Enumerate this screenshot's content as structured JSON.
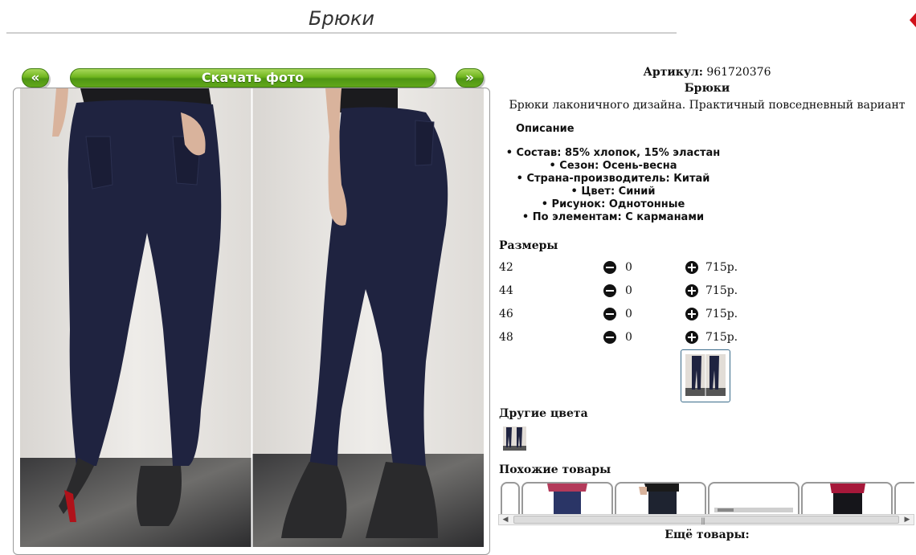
{
  "page": {
    "title": "Брюки"
  },
  "nav": {
    "prev_label": "«",
    "download_label": "Скачать фото",
    "next_label": "»"
  },
  "product": {
    "article_label": "Артикул:",
    "article_value": "961720376",
    "name": "Брюки",
    "short_description": "Брюки лаконичного дизайна. Практичный повседневный вариант"
  },
  "description": {
    "heading": "Описание",
    "items": [
      "Состав: 85% хлопок, 15% эластан",
      "Сезон: Осень-весна",
      "Страна-производитель: Китай",
      "Цвет: Синий",
      "Рисунок: Однотонные",
      "По элементам: С карманами"
    ]
  },
  "sizes": {
    "heading": "Размеры",
    "rows": [
      {
        "size": "42",
        "qty": "0",
        "price": "715р."
      },
      {
        "size": "44",
        "qty": "0",
        "price": "715р."
      },
      {
        "size": "46",
        "qty": "0",
        "price": "715р."
      },
      {
        "size": "48",
        "qty": "0",
        "price": "715р."
      }
    ]
  },
  "other_colors": {
    "heading": "Другие цвета"
  },
  "similar": {
    "heading": "Похожие товары"
  },
  "more": {
    "heading": "Ещё товары:"
  },
  "colors": {
    "accent_green": "#6fb51e",
    "pants_navy": "#1f2340",
    "wall": "#e7e5e3"
  }
}
